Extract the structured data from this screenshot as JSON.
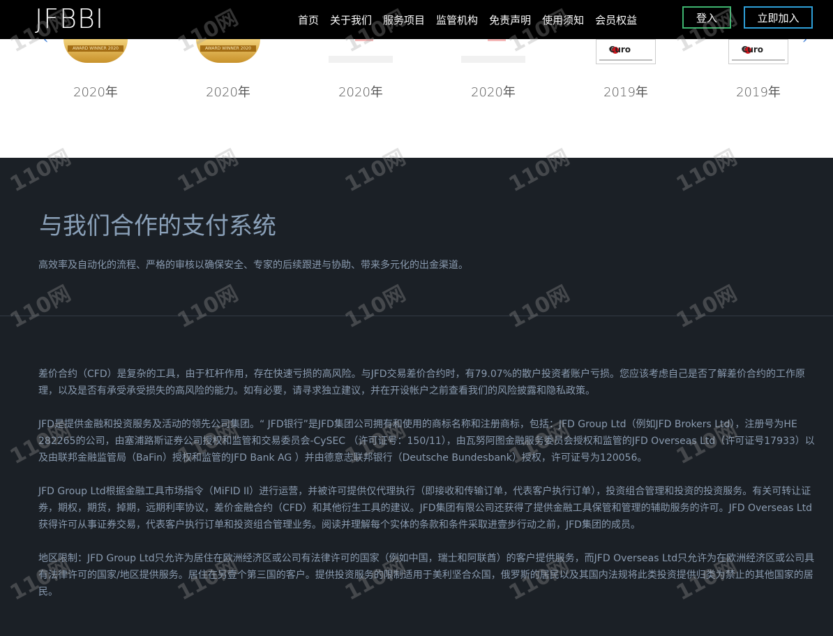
{
  "header": {
    "logo": "JFBBI",
    "nav": [
      "首页",
      "关于我们",
      "服务项目",
      "监管机构",
      "免责声明",
      "使用须知",
      "会员权益"
    ],
    "login_label": "登入",
    "join_label": "立即加入"
  },
  "awards": [
    {
      "year": "2020年",
      "kind": "medal",
      "ribbon": "AWARD WINNER 2020"
    },
    {
      "year": "2020年",
      "kind": "medal",
      "ribbon": "AWARD WINNER 2020"
    },
    {
      "year": "2020年",
      "kind": "faded"
    },
    {
      "year": "2020年",
      "kind": "faded"
    },
    {
      "year": "2019年",
      "kind": "euro",
      "text": "€uro"
    },
    {
      "year": "2019年",
      "kind": "euro",
      "text": "€uro"
    }
  ],
  "payment": {
    "title": "与我们合作的支付系统",
    "subtitle": "高效率及自动化的流程、严格的审核以确保安全、专家的后续跟进与协助、带来多元化的出金渠道。"
  },
  "disclaimer": {
    "p1": "差价合约（CFD）是复杂的工具，由于杠杆作用，存在快速亏损的高风险。与JFD交易差价合约时，有79.07%的散户投资者账户亏损。您应该考虑自己是否了解差价合约的工作原理，以及是否有承受承受损失的高风险的能力。如有必要，请寻求独立建议，并在开设帐户之前查看我们的风险披露和隐私政策。",
    "p2": "JFD是提供金融和投资服务及活动的领先公司集团。“ JFD银行”是JFD集团公司拥有和使用的商标名称和注册商标，包括：JFD Group Ltd（例如JFD Brokers Ltd），注册号为HE 282265的公司，由塞浦路斯证券公司授权和监管和交易委员会-CySEC （许可证号：150/11），由瓦努阿图金融服务委员会授权和监管的JFD Overseas Ltd（许可证号17933）以及由联邦金融监管局（BaFin）授权和监管的JFD Bank AG ）并由德意志联邦银行（Deutsche Bundesbank）授权，许可证号为120056。",
    "p3": "JFD Group Ltd根据金融工具市场指令（MiFID II）进行运营，并被许可提供仅代理执行（即接收和传输订单，代表客户执行订单），投资组合管理和投资的投资服务。有关可转让证券，期权，期货，掉期，远期利率协议，差价金融合约（CFD）和其他衍生工具的建议。JFD集团有限公司还获得了提供金融工具保管和管理的辅助服务的许可。JFD Overseas Ltd获得许可从事证券交易，代表客户执行订单和投资组合管理业务。阅读并理解每个实体的条款和条件采取进壹步行动之前，JFD集团的成员。",
    "p4": "地区限制：JFD Group Ltd只允许为居住在欧洲经济区或公司有法律许可的国家（例如中国，瑞士和阿联酋）的客户提供服务，而JFD Overseas Ltd只允许为在欧洲经济区或公司具有法律许可的国家/地区提供服务。居住在另壹个第三国的客户。提供投资服务的限制适用于美利坚合众国，俄罗斯的居民以及其国内法规将此类投资提供归类为禁止的其他国家的居民。"
  },
  "watermark": "110网"
}
